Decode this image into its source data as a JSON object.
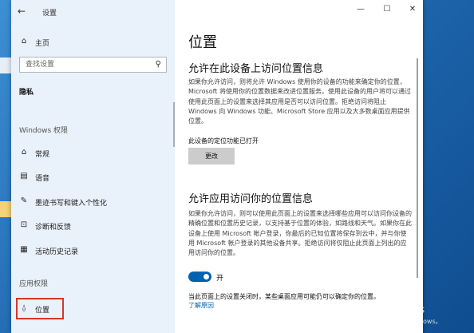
{
  "window": {
    "title": "设置",
    "controls": {
      "minimize": "—",
      "maximize": "☐",
      "close": "✕"
    }
  },
  "sidebar": {
    "home": "主页",
    "search_placeholder": "查找设置",
    "category": "隐私",
    "section_windows": "Windows 权限",
    "windows_items": [
      {
        "icon": "home-icon",
        "label": "常规"
      },
      {
        "icon": "speech-icon",
        "label": "语音"
      },
      {
        "icon": "pen-icon",
        "label": "墨迹书写和键入个性化"
      },
      {
        "icon": "feedback-icon",
        "label": "诊断和反馈"
      },
      {
        "icon": "history-icon",
        "label": "活动历史记录"
      }
    ],
    "section_app": "应用权限",
    "app_items": [
      {
        "icon": "location-icon",
        "label": "位置",
        "selected": true
      }
    ]
  },
  "content": {
    "page_title": "位置",
    "device_section": {
      "heading": "允许在此设备上访问位置信息",
      "description": "如果你允许访问，则将允许 Windows 使用你的设备的功能来确定你的位置，Microsoft 将使用你的位置数据来改进位置服务。使用此设备的用户将可以通过使用此页面上的设置来选择其应用是否可以访问位置。拒绝访问将阻止 Windows 向 Windows 功能、Microsoft Store 应用以及大多数桌面应用提供位置。",
      "status": "此设备的定位功能已打开",
      "change_button": "更改"
    },
    "app_section": {
      "heading": "允许应用访问你的位置信息",
      "description": "如果你允许访问，则可以使用此页面上的设置来选择哪些应用可以访问你设备的精确位置和位置历史记录，以支持基于位置的体验，如路线和天气。如果你在此设备上使用 Microsoft 帐户登录，你最后的已知位置将保存到云中，并与你使用 Microsoft 帐户登录的其他设备共享。拒绝访问将仅阻止此页面上列出的应用访问你的位置。",
      "toggle_on": true,
      "toggle_label": "开",
      "note": "当此页面上的设置关闭时，某些桌面应用可能仍可以确定你的位置。",
      "learn_more": "了解原因"
    }
  },
  "watermark": {
    "line1": "激活 Windows",
    "line2": "转到\"设置\"以激活 Windows。"
  },
  "colors": {
    "accent": "#0063b1",
    "sidebar_bg": "#e9f1fa",
    "highlight": "#d9342b"
  }
}
